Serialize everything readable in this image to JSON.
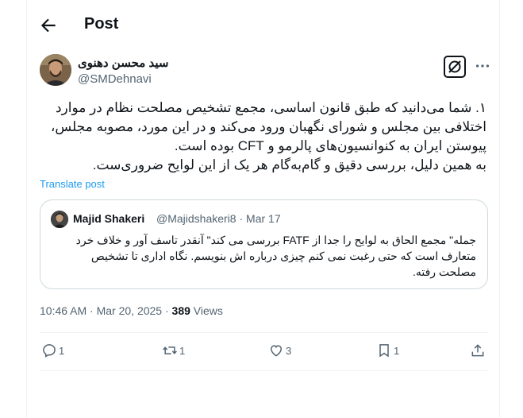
{
  "header": {
    "title": "Post"
  },
  "author": {
    "name": "سید محسن دهنوی",
    "handle": "@SMDehnavi"
  },
  "post": {
    "lines": [
      "۱. شما می‌دانید که طبق قانون اساسی، مجمع تشخیص مصلحت نظام در موارد",
      "اختلافی بین مجلس و شورای نگهبان ورود می‌کند و در این مورد، مصوبه مجلس،",
      "پیوستن ایران به کنوانسیون‌های پالرمو و CFT بوده است.",
      "به همین دلیل، بررسی دقیق و گام‌به‌گام هر یک از این لوایح ضروری‌ست."
    ],
    "translate": "Translate post"
  },
  "quote": {
    "name": "Majid Shakeri",
    "handle": "@Majidshakeri8",
    "dot": "·",
    "date": "Mar 17",
    "lines": [
      "جمله\" مجمع الحاق به لوایح را جدا از FATF بررسی می کند\" آنقدر تاسف آور و خلاف خرد",
      "متعارف است که حتی رغبت نمی کنم چیزی درباره اش بنویسم. نگاه اداری تا تشخیص",
      "مصلحت رفته."
    ]
  },
  "meta": {
    "time": "10:46 AM · Mar 20, 2025 · ",
    "views_count": "389",
    "views_label": " Views"
  },
  "actions": {
    "replies": "1",
    "reposts": "1",
    "likes": "3",
    "bookmarks": "1"
  },
  "colors": {
    "accent": "#1d9bf0",
    "muted": "#536471",
    "border": "#cfd9de"
  },
  "icons": [
    "back-arrow-icon",
    "grok-icon",
    "more-icon",
    "reply-icon",
    "repost-icon",
    "like-icon",
    "bookmark-icon",
    "share-icon"
  ]
}
